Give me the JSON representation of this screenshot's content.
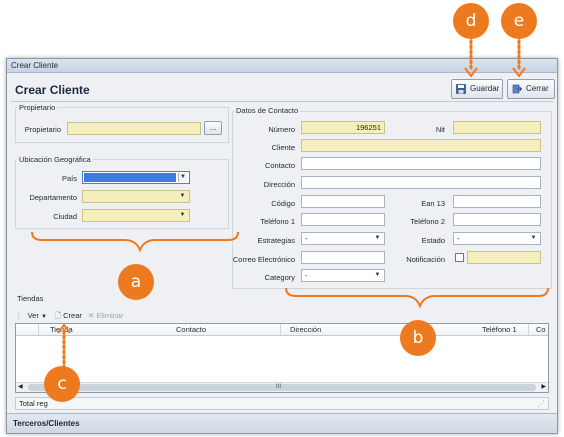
{
  "window": {
    "title": "Crear Cliente"
  },
  "form": {
    "title": "Crear Cliente"
  },
  "toolbar": {
    "save_label": "Guardar",
    "close_label": "Cerrar"
  },
  "propietario": {
    "group_title": "Propietario",
    "label": "Propietario",
    "value": "",
    "browse_label": "..."
  },
  "ubicacion": {
    "group_title": "Ubicación Geográfica",
    "pais_label": "País",
    "pais_value": "",
    "departamento_label": "Departamento",
    "departamento_value": "",
    "ciudad_label": "Ciudad",
    "ciudad_value": ""
  },
  "contacto": {
    "group_title": "Datos de Contacto",
    "numero_label": "Número",
    "numero_value": "196251",
    "nit_label": "Nit",
    "cliente_label": "Cliente",
    "contacto_label": "Contacto",
    "direccion_label": "Dirección",
    "codigo_label": "Código",
    "ean_label": "Ean 13",
    "telefono1_label": "Teléfono 1",
    "telefono2_label": "Teléfono 2",
    "estrategias_label": "Estrategias",
    "estrategias_value": "-",
    "estado_label": "Estado",
    "estado_value": "-",
    "correo_label": "Correo Electrónico",
    "notificacion_label": "Notificación",
    "category_label": "Category",
    "category_value": "-"
  },
  "tiendas": {
    "group_title": "Tiendas",
    "ver_label": "Ver",
    "crear_label": "Crear",
    "eliminar_label": "Eliminar",
    "columns": [
      "Tienda",
      "Contacto",
      "Dirección",
      "Teléfono 1",
      "Co"
    ],
    "total_label": "Total reg",
    "scroll_label": "III"
  },
  "footer": {
    "tab_label": "Terceros/Clientes"
  },
  "callouts": {
    "a": "a",
    "b": "b",
    "c": "c",
    "d": "d",
    "e": "e"
  },
  "colors": {
    "accent": "#ee7a20",
    "required_field": "#f4efbd",
    "selection": "#3a7de0"
  }
}
